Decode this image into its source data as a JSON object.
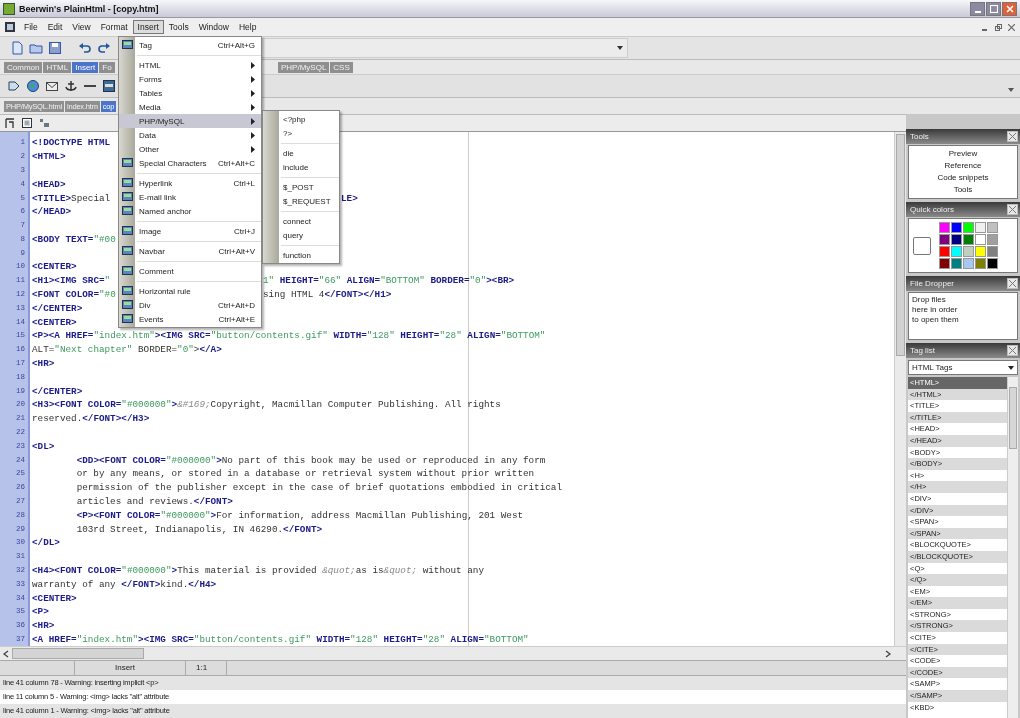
{
  "window": {
    "title": "Beerwin's PlainHtml - [copy.htm]"
  },
  "menu_bar": [
    {
      "label": "File",
      "selected": false
    },
    {
      "label": "Edit",
      "selected": false
    },
    {
      "label": "View",
      "selected": false
    },
    {
      "label": "Format",
      "selected": false
    },
    {
      "label": "Insert",
      "selected": true
    },
    {
      "label": "Tools",
      "selected": false
    },
    {
      "label": "Window",
      "selected": false
    },
    {
      "label": "Help",
      "selected": false
    }
  ],
  "toolbar_tabs": [
    {
      "label": "Common",
      "selected": false
    },
    {
      "label": "HTML",
      "selected": false
    },
    {
      "label": "Insert",
      "selected": true
    },
    {
      "label": "Fo",
      "selected": false
    },
    {
      "label": "PHP/MySQL",
      "selected": false
    },
    {
      "label": "CSS",
      "selected": false
    }
  ],
  "document_tabs": [
    {
      "label": "PHP/MySQL.html",
      "selected": false
    },
    {
      "label": "index.htm",
      "selected": false
    },
    {
      "label": "cop",
      "selected": true
    }
  ],
  "insert_menu": [
    {
      "kind": "item",
      "label": "Tag",
      "shortcut": "Ctrl+Alt+G",
      "submenu": false,
      "icon": true,
      "selected": false
    },
    {
      "kind": "separator"
    },
    {
      "kind": "item",
      "label": "HTML",
      "submenu": true,
      "icon": false,
      "selected": false
    },
    {
      "kind": "item",
      "label": "Forms",
      "submenu": true,
      "icon": false,
      "selected": false
    },
    {
      "kind": "item",
      "label": "Tables",
      "submenu": true,
      "icon": false,
      "selected": false
    },
    {
      "kind": "item",
      "label": "Media",
      "submenu": true,
      "icon": false,
      "selected": false
    },
    {
      "kind": "item",
      "label": "PHP/MySQL",
      "submenu": true,
      "icon": false,
      "selected": true
    },
    {
      "kind": "item",
      "label": "Data",
      "submenu": true,
      "icon": false,
      "selected": false
    },
    {
      "kind": "item",
      "label": "Other",
      "submenu": true,
      "icon": false,
      "selected": false
    },
    {
      "kind": "item",
      "label": "Special Characters",
      "shortcut": "Ctrl+Alt+C",
      "submenu": false,
      "icon": true,
      "selected": false
    },
    {
      "kind": "separator"
    },
    {
      "kind": "item",
      "label": "Hyperlink",
      "shortcut": "Ctrl+L",
      "submenu": false,
      "icon": true,
      "selected": false
    },
    {
      "kind": "item",
      "label": "E-mail link",
      "submenu": false,
      "icon": true,
      "selected": false
    },
    {
      "kind": "item",
      "label": "Named anchor",
      "submenu": false,
      "icon": true,
      "selected": false
    },
    {
      "kind": "separator"
    },
    {
      "kind": "item",
      "label": "Image",
      "shortcut": "Ctrl+J",
      "submenu": false,
      "icon": true,
      "selected": false
    },
    {
      "kind": "separator"
    },
    {
      "kind": "item",
      "label": "Navbar",
      "shortcut": "Ctrl+Alt+V",
      "submenu": false,
      "icon": true,
      "selected": false
    },
    {
      "kind": "separator"
    },
    {
      "kind": "item",
      "label": "Comment",
      "submenu": false,
      "icon": true,
      "selected": false
    },
    {
      "kind": "separator"
    },
    {
      "kind": "item",
      "label": "Horizontal rule",
      "submenu": false,
      "icon": true,
      "selected": false
    },
    {
      "kind": "item",
      "label": "Div",
      "shortcut": "Ctrl+Alt+D",
      "submenu": false,
      "icon": true,
      "selected": false
    },
    {
      "kind": "item",
      "label": "Events",
      "shortcut": "Ctrl+Alt+E",
      "submenu": false,
      "icon": true,
      "selected": false
    }
  ],
  "php_submenu": [
    {
      "kind": "item",
      "label": "<?php"
    },
    {
      "kind": "item",
      "label": "?>"
    },
    {
      "kind": "separator"
    },
    {
      "kind": "item",
      "label": "die"
    },
    {
      "kind": "item",
      "label": "include"
    },
    {
      "kind": "separator"
    },
    {
      "kind": "item",
      "label": "$_POST"
    },
    {
      "kind": "item",
      "label": "$_REQUEST"
    },
    {
      "kind": "separator"
    },
    {
      "kind": "item",
      "label": "connect"
    },
    {
      "kind": "item",
      "label": "query"
    },
    {
      "kind": "separator"
    },
    {
      "kind": "item",
      "label": "function"
    }
  ],
  "editor": {
    "lines": [
      {
        "number": "1",
        "text": "<!DOCTYPE HTML"
      },
      {
        "number": "2",
        "text": "<HTML>"
      },
      {
        "number": "3"
      },
      {
        "number": "4",
        "text": "<HEAD>"
      },
      {
        "number": "5",
        "text": "<TITLE>Special",
        "text_after_menu": "LE>"
      },
      {
        "number": "6",
        "text": "</HEAD>"
      },
      {
        "number": "7"
      },
      {
        "number": "8",
        "text": "<BODY TEXT=\"#00"
      },
      {
        "number": "9"
      },
      {
        "number": "10",
        "text": "<CENTER>"
      },
      {
        "number": "11",
        "text": "<H1><IMG SRC=\"",
        "text_after_menu": "1\" HEIGHT=\"66\" ALIGN=\"BOTTOM\" BORDER=\"0\"><BR>"
      },
      {
        "number": "12",
        "text": "<FONT COLOR=\"#0",
        "text_after_menu": "sing HTML 4</FONT></H1>"
      },
      {
        "number": "13",
        "text": "</CENTER>"
      },
      {
        "number": "14",
        "text": "<CENTER>"
      },
      {
        "number": "15",
        "text": "<P><A HREF=\"index.htm\"><IMG SRC=\"button/contents.gif\" WIDTH=\"128\" HEIGHT=\"28\" ALIGN=\"BOTTOM\""
      },
      {
        "number": "16",
        "text": "ALT=\"Next chapter\" BORDER=\"0\"></A>"
      },
      {
        "number": "17",
        "text": "<HR>"
      },
      {
        "number": "18"
      },
      {
        "number": "19",
        "text": "</CENTER>"
      },
      {
        "number": "20",
        "text": "<H3><FONT COLOR=\"#000000\">&#169;Copyright, Macmillan Computer Publishing. All rights"
      },
      {
        "number": "21",
        "text": "reserved.</FONT></H3>"
      },
      {
        "number": "22"
      },
      {
        "number": "23",
        "text": "<DL>"
      },
      {
        "number": "24",
        "text": "        <DD><FONT COLOR=\"#000000\">No part of this book may be used or reproduced in any form"
      },
      {
        "number": "25",
        "text": "        or by any means, or stored in a database or retrieval system without prior written"
      },
      {
        "number": "26",
        "text": "        permission of the publisher except in the case of brief quotations embodied in critical"
      },
      {
        "number": "27",
        "text": "        articles and reviews.</FONT>"
      },
      {
        "number": "28",
        "text": "        <P><FONT COLOR=\"#000000\">For information, address Macmillan Publishing, 201 West"
      },
      {
        "number": "29",
        "text": "        103rd Street, Indianapolis, IN 46290.</FONT>"
      },
      {
        "number": "30",
        "text": "</DL>"
      },
      {
        "number": "31"
      },
      {
        "number": "32",
        "text": "<H4><FONT COLOR=\"#000000\">This material is provided &quot;as is&quot; without any"
      },
      {
        "number": "33",
        "text": "warranty of any </FONT>kind.</H4>"
      },
      {
        "number": "34",
        "text": "<CENTER>"
      },
      {
        "number": "35",
        "text": "<P>"
      },
      {
        "number": "36",
        "text": "<HR>"
      },
      {
        "number": "37",
        "text": "<A HREF=\"index.htm\"><IMG SRC=\"button/contents.gif\" WIDTH=\"128\" HEIGHT=\"28\" ALIGN=\"BOTTOM\""
      }
    ]
  },
  "status_bar": {
    "mode": "Insert",
    "position": "1:1"
  },
  "messages": [
    "line 41 column 78 - Warning: inserting implicit <p>",
    "line 11 column 5 - Warning: <img> lacks \"alt\" attribute",
    "line 41 column 1 - Warning: <img> lacks \"alt\" attribute"
  ],
  "panels": {
    "tools": {
      "title": "Tools",
      "items": [
        "Preview",
        "Reference",
        "Code snippets",
        "Tools"
      ]
    },
    "quick_colors": {
      "title": "Quick colors",
      "swatches": [
        {
          "color": "#ff00ff"
        },
        {
          "color": "#0000ff"
        },
        {
          "color": "#00ff00"
        },
        {
          "color": "#f0f0f0"
        },
        {
          "color": "#c0c0c0"
        },
        {
          "color": "#800080"
        },
        {
          "color": "#000080"
        },
        {
          "color": "#008000"
        },
        {
          "color": "#ffffff"
        },
        {
          "color": "#a0a0a0"
        },
        {
          "color": "#ff0000"
        },
        {
          "color": "#00ffff"
        },
        {
          "color": "#c0d0c0"
        },
        {
          "color": "#ffff00"
        },
        {
          "color": "#808080"
        },
        {
          "color": "#800000"
        },
        {
          "color": "#008080"
        },
        {
          "color": "#a8c8f0"
        },
        {
          "color": "#808000"
        },
        {
          "color": "#000000"
        }
      ]
    },
    "file_dropper": {
      "title": "File Dropper",
      "text": "Drop files here in order to open them"
    },
    "tag_list": {
      "title": "Tag list",
      "filter": "HTML Tags",
      "items": [
        {
          "label": "<HTML>",
          "selected": true
        },
        {
          "label": "</HTML>",
          "selected": false
        },
        {
          "label": "<TITLE>",
          "selected": false
        },
        {
          "label": "</TITLE>",
          "selected": false
        },
        {
          "label": "<HEAD>",
          "selected": false
        },
        {
          "label": "</HEAD>",
          "selected": false
        },
        {
          "label": "<BODY>",
          "selected": false
        },
        {
          "label": "</BODY>",
          "selected": false
        },
        {
          "label": "<H>",
          "selected": false
        },
        {
          "label": "</H>",
          "selected": false
        },
        {
          "label": "<DIV>",
          "selected": false
        },
        {
          "label": "</DIV>",
          "selected": false
        },
        {
          "label": "<SPAN>",
          "selected": false
        },
        {
          "label": "</SPAN>",
          "selected": false
        },
        {
          "label": "<BLOCKQUOTE>",
          "selected": false
        },
        {
          "label": "</BLOCKQUOTE>",
          "selected": false
        },
        {
          "label": "<Q>",
          "selected": false
        },
        {
          "label": "</Q>",
          "selected": false
        },
        {
          "label": "<EM>",
          "selected": false
        },
        {
          "label": "</EM>",
          "selected": false
        },
        {
          "label": "<STRONG>",
          "selected": false
        },
        {
          "label": "</STRONG>",
          "selected": false
        },
        {
          "label": "<CITE>",
          "selected": false
        },
        {
          "label": "</CITE>",
          "selected": false
        },
        {
          "label": "<CODE>",
          "selected": false
        },
        {
          "label": "</CODE>",
          "selected": false
        },
        {
          "label": "<SAMP>",
          "selected": false
        },
        {
          "label": "</SAMP>",
          "selected": false
        },
        {
          "label": "<KBD>",
          "selected": false
        }
      ]
    }
  }
}
